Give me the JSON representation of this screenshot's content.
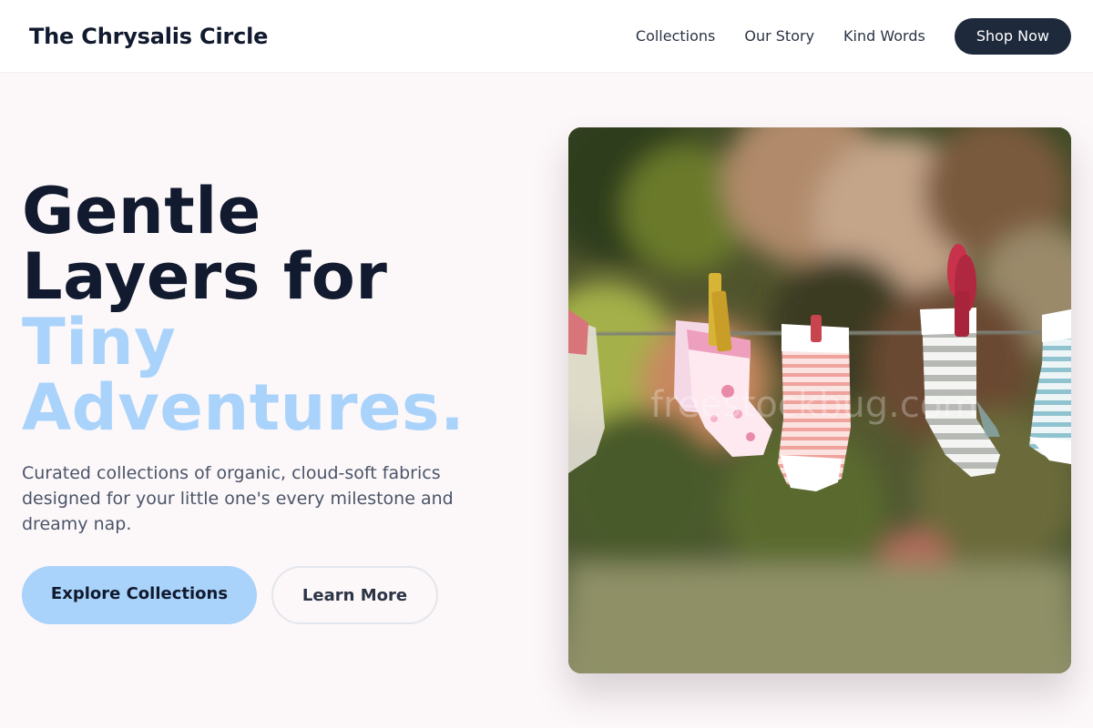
{
  "header": {
    "brand": "The Chrysalis Circle",
    "nav": [
      "Collections",
      "Our Story",
      "Kind Words"
    ],
    "cta": "Shop Now"
  },
  "hero": {
    "title_line1": "Gentle",
    "title_line2": "Layers for",
    "title_accent1": "Tiny",
    "title_accent2": "Adventures.",
    "subtitle": "Curated collections of organic, cloud-soft fabrics designed for your little one's every milestone and dreamy nap.",
    "primary_button": "Explore Collections",
    "secondary_button": "Learn More",
    "image_alt": "Baby socks hanging on a clothesline with clothespins",
    "image_watermark": "freestockbug.com"
  },
  "colors": {
    "accent": "#a9d3fb",
    "dark": "#1e2a3c",
    "background": "#fcf7f9"
  }
}
